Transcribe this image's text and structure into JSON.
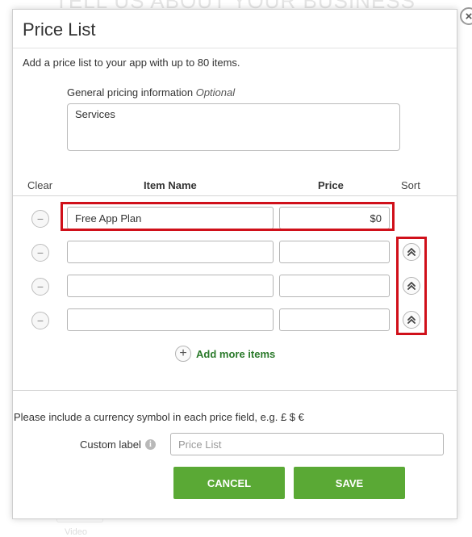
{
  "background": {
    "heading": "TELL US ABOUT YOUR BUSINESS",
    "caption": "Video"
  },
  "dialog": {
    "title": "Price List",
    "close_symbol": "×",
    "intro": "Add a price list to your app with up to 80 items.",
    "general_label": "General pricing information",
    "general_optional": "Optional",
    "general_value": "Services",
    "columns": {
      "clear": "Clear",
      "name": "Item Name",
      "price": "Price",
      "sort": "Sort"
    },
    "rows": [
      {
        "name": "Free App Plan",
        "price": "$0"
      },
      {
        "name": "",
        "price": ""
      },
      {
        "name": "",
        "price": ""
      },
      {
        "name": "",
        "price": ""
      }
    ],
    "add_more": "Add more items",
    "currency_note": "Please include a currency symbol in each price field, e.g. £ $ €",
    "custom_label": "Custom label",
    "custom_placeholder": "Price List",
    "cancel": "CANCEL",
    "save": "SAVE"
  },
  "colors": {
    "accent_green": "#5aa935",
    "link_green": "#2b7a2b",
    "highlight_red": "#d0101a"
  },
  "icons": {
    "close": "close-icon",
    "minus": "minus-circle-icon",
    "sort": "double-chevron-up-icon",
    "add": "plus-circle-icon",
    "info": "info-icon"
  }
}
